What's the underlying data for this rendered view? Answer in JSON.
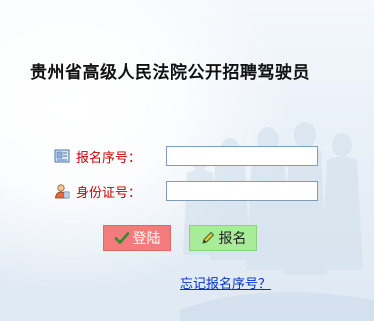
{
  "title": "贵州省高级人民法院公开招聘驾驶员",
  "form": {
    "registration_number_label": "报名序号：",
    "registration_number_value": "",
    "id_number_label": "身份证号：",
    "id_number_value": ""
  },
  "buttons": {
    "login_label": "登陆",
    "register_label": "报名"
  },
  "links": {
    "forgot_label": "忘记报名序号？"
  },
  "icons": {
    "registration_number": "id-card-icon",
    "id_number": "user-icon",
    "login": "checkmark-icon",
    "register": "pencil-icon"
  },
  "colors": {
    "label_red": "#cc0000",
    "login_button": "#f47b7b",
    "register_button": "#a8ec9a",
    "link_blue": "#0033cc"
  }
}
